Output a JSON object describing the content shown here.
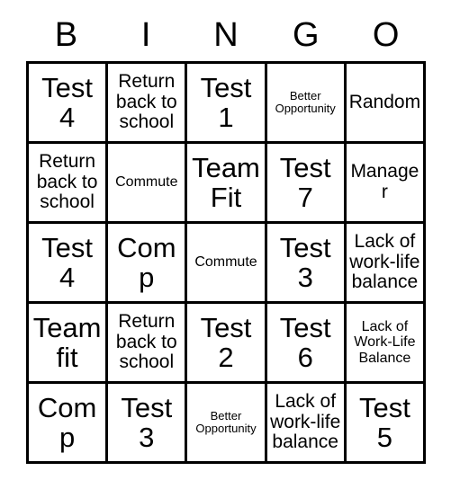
{
  "card": {
    "headers": [
      "B",
      "I",
      "N",
      "G",
      "O"
    ],
    "rows": [
      [
        {
          "text": "Test 4",
          "size": "xl"
        },
        {
          "text": "Return back to school",
          "size": "md"
        },
        {
          "text": "Test 1",
          "size": "xl"
        },
        {
          "text": "Better Opportunity",
          "size": "xs"
        },
        {
          "text": "Random",
          "size": "md"
        }
      ],
      [
        {
          "text": "Return back to school",
          "size": "md"
        },
        {
          "text": "Commute",
          "size": "sm"
        },
        {
          "text": "Team Fit",
          "size": "xl"
        },
        {
          "text": "Test 7",
          "size": "xl"
        },
        {
          "text": "Manager",
          "size": "md"
        }
      ],
      [
        {
          "text": "Test 4",
          "size": "xl"
        },
        {
          "text": "Comp",
          "size": "xl"
        },
        {
          "text": "Commute",
          "size": "sm"
        },
        {
          "text": "Test 3",
          "size": "xl"
        },
        {
          "text": "Lack of work-life balance",
          "size": "md"
        }
      ],
      [
        {
          "text": "Team fit",
          "size": "xl"
        },
        {
          "text": "Return back to school",
          "size": "md"
        },
        {
          "text": "Test 2",
          "size": "xl"
        },
        {
          "text": "Test 6",
          "size": "xl"
        },
        {
          "text": "Lack of Work-Life Balance",
          "size": "sm"
        }
      ],
      [
        {
          "text": "Comp",
          "size": "xl"
        },
        {
          "text": "Test 3",
          "size": "xl"
        },
        {
          "text": "Better Opportunity",
          "size": "xs"
        },
        {
          "text": "Lack of work-life balance",
          "size": "md"
        },
        {
          "text": "Test 5",
          "size": "xl"
        }
      ]
    ]
  },
  "colors": {
    "border": "#000000",
    "text": "#000000",
    "background": "#ffffff"
  }
}
